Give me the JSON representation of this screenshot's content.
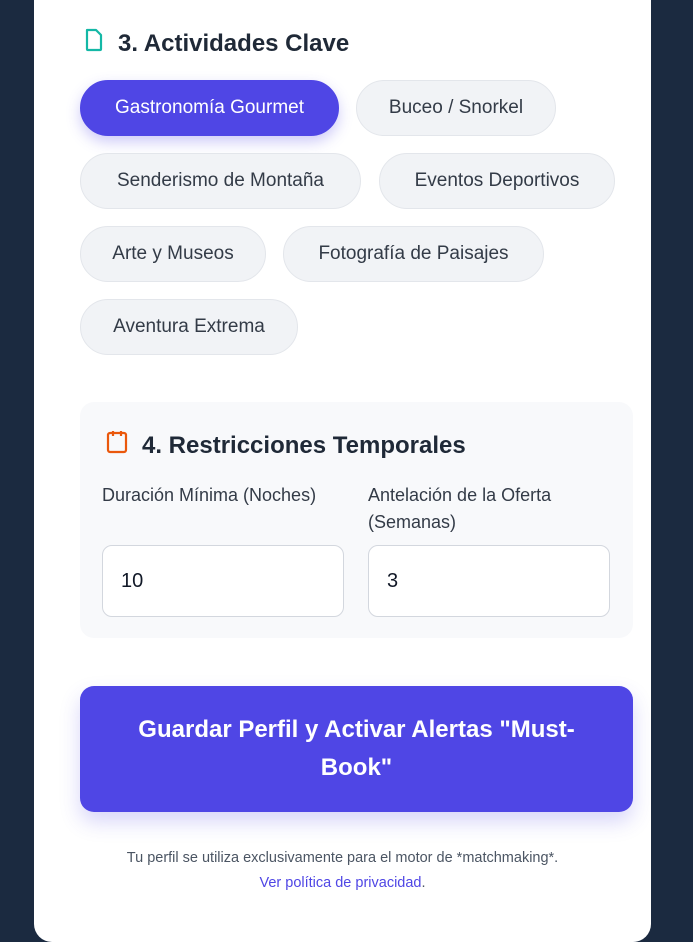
{
  "activities": {
    "title": "3. Actividades Clave",
    "icon": "document-icon",
    "icon_color": "#14b8a6",
    "chips": [
      {
        "label": "Gastronomía Gourmet",
        "selected": true
      },
      {
        "label": "Buceo / Snorkel",
        "selected": false
      },
      {
        "label": "Senderismo de Montaña",
        "selected": false
      },
      {
        "label": "Eventos Deportivos",
        "selected": false
      },
      {
        "label": "Arte y Museos",
        "selected": false
      },
      {
        "label": "Fotografía de Paisajes",
        "selected": false
      },
      {
        "label": "Aventura Extrema",
        "selected": false
      }
    ]
  },
  "restrictions": {
    "title": "4. Restricciones Temporales",
    "icon": "calendar-icon",
    "icon_color": "#ea580c",
    "min_duration": {
      "label": "Duración Mínima (Noches)",
      "value": "10"
    },
    "lead_time": {
      "label": "Antelación de la Oferta (Semanas)",
      "value": "3"
    }
  },
  "save_button": {
    "label": "Guardar Perfil y Activar Alertas \"Must-Book\""
  },
  "footer": {
    "note": "Tu perfil se utiliza exclusivamente para el motor de *matchmaking*.",
    "privacy_link": "Ver política de privacidad",
    "period": "."
  },
  "colors": {
    "accent": "#4f46e5",
    "background": "#1b2a40"
  }
}
